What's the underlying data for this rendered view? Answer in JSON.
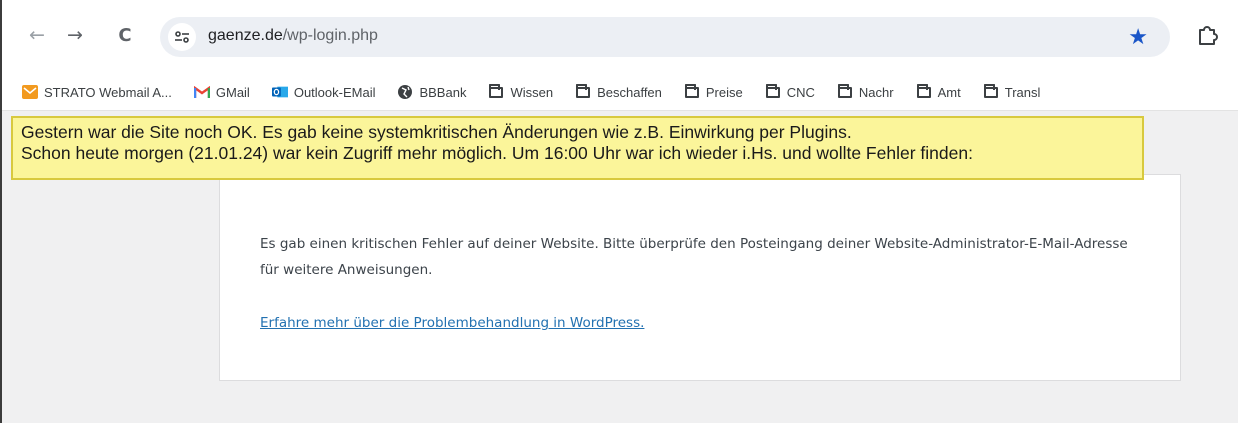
{
  "browser": {
    "url_domain": "gaenze.de",
    "url_path": "/wp-login.php",
    "back_icon": "←",
    "forward_icon": "→",
    "reload_icon": "C",
    "bookmark_star": "★"
  },
  "bookmarks": [
    {
      "label": "STRATO Webmail A...",
      "icon": "strato-icon"
    },
    {
      "label": "GMail",
      "icon": "gmail-icon"
    },
    {
      "label": "Outlook-EMail",
      "icon": "outlook-icon"
    },
    {
      "label": "BBBank",
      "icon": "globe-icon"
    },
    {
      "label": "Wissen",
      "icon": "folder-icon"
    },
    {
      "label": "Beschaffen",
      "icon": "folder-icon"
    },
    {
      "label": "Preise",
      "icon": "folder-icon"
    },
    {
      "label": "CNC",
      "icon": "folder-icon"
    },
    {
      "label": "Nachr",
      "icon": "folder-icon"
    },
    {
      "label": "Amt",
      "icon": "folder-icon"
    },
    {
      "label": "Transl",
      "icon": "folder-icon"
    }
  ],
  "annotation": {
    "line1": "Gestern war die Site noch OK. Es gab keine systemkritischen  Änderungen wie z.B. Einwirkung per Plugins.",
    "line2": "Schon heute morgen (21.01.24) war kein Zugriff mehr möglich. Um 16:00 Uhr war ich wieder i.Hs. und wollte Fehler finden:"
  },
  "error": {
    "message": "Es gab einen kritischen Fehler auf deiner Website. Bitte überprüfe den Posteingang deiner Website-Administrator-E-Mail-Adresse für weitere Anweisungen.",
    "link": "Erfahre mehr über die Problembehandlung in WordPress."
  },
  "colors": {
    "annotation_bg": "#fbf59a",
    "link": "#2271b1",
    "star": "#1a56c8"
  }
}
